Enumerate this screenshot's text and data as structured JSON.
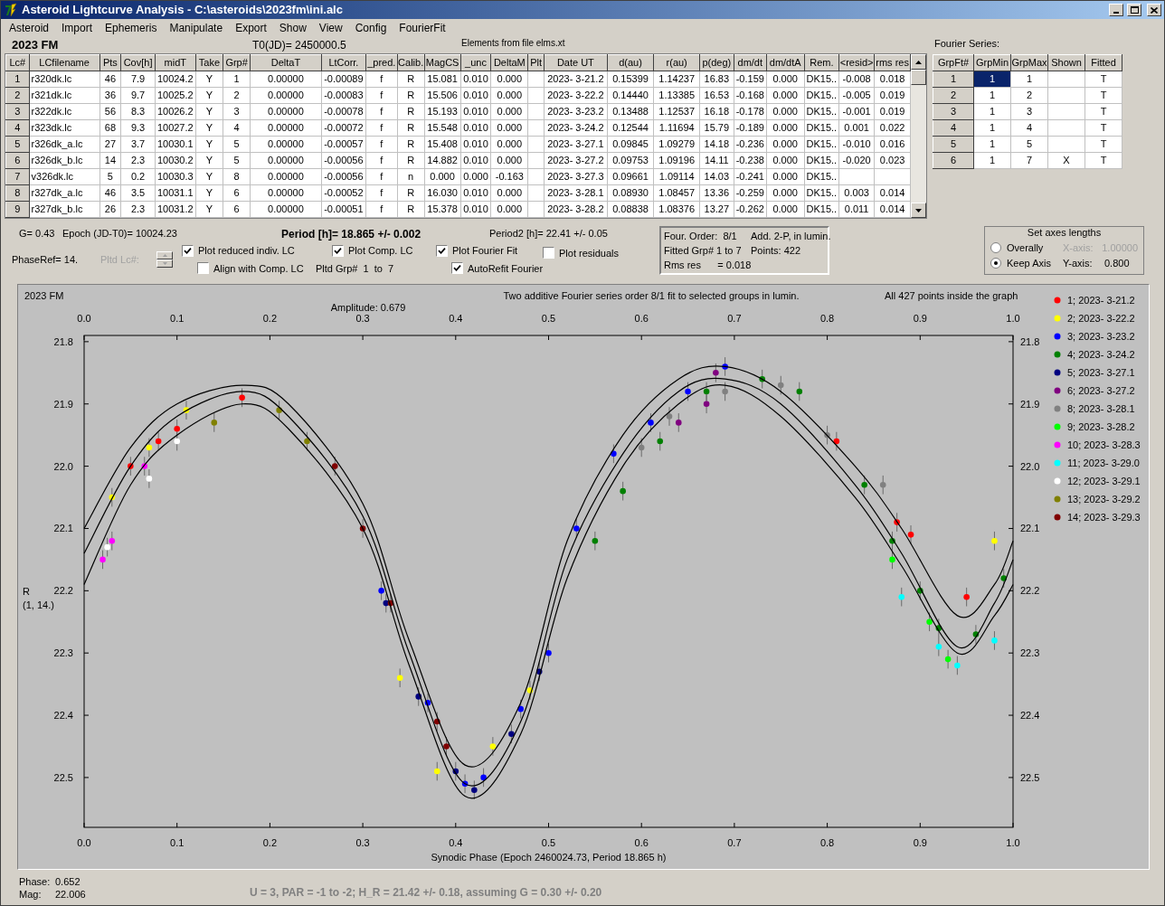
{
  "window": {
    "title": "Asteroid Lightcurve Analysis - C:\\asteroids\\2023fm\\ini.alc"
  },
  "menu": [
    "Asteroid",
    "Import",
    "Ephemeris",
    "Manipulate",
    "Export",
    "Show",
    "View",
    "Config",
    "FourierFit"
  ],
  "asteroid_name": "2023 FM",
  "t0": "T0(JD)= 2450000.5",
  "elements_note": "Elements from file elms.xt",
  "lc_table": {
    "columns": [
      "Lc#",
      "LCfilename",
      "Pts",
      "Cov[h]",
      "midT",
      "Take",
      "Grp#",
      "DeltaT",
      "LtCorr.",
      "_pred.",
      "Calib.",
      "MagCS",
      "_unc",
      "DeltaM",
      "Plt",
      "Date UT",
      "d(au)",
      "r(au)",
      "p(deg)",
      "dm/dt",
      "dm/dtA",
      "Rem.",
      "<resid>",
      "rms res"
    ],
    "rows": [
      {
        "cells": [
          "1",
          "r320dk.lc",
          "46",
          "7.9",
          "10024.2",
          "Y",
          "1",
          "0.00000",
          "-0.00089",
          "f",
          "R",
          "15.081",
          "0.010",
          "0.000",
          null,
          "2023- 3-21.2",
          "0.15399",
          "1.14237",
          "16.83",
          "-0.159",
          "0.000",
          "DK15..",
          "-0.008",
          "0.018"
        ]
      },
      {
        "cells": [
          "2",
          "r321dk.lc",
          "36",
          "9.7",
          "10025.2",
          "Y",
          "2",
          "0.00000",
          "-0.00083",
          "f",
          "R",
          "15.506",
          "0.010",
          "0.000",
          null,
          "2023- 3-22.2",
          "0.14440",
          "1.13385",
          "16.53",
          "-0.168",
          "0.000",
          "DK15..",
          "-0.005",
          "0.019"
        ]
      },
      {
        "cells": [
          "3",
          "r322dk.lc",
          "56",
          "8.3",
          "10026.2",
          "Y",
          "3",
          "0.00000",
          "-0.00078",
          "f",
          "R",
          "15.193",
          "0.010",
          "0.000",
          null,
          "2023- 3-23.2",
          "0.13488",
          "1.12537",
          "16.18",
          "-0.178",
          "0.000",
          "DK15..",
          "-0.001",
          "0.019"
        ]
      },
      {
        "cells": [
          "4",
          "r323dk.lc",
          "68",
          "9.3",
          "10027.2",
          "Y",
          "4",
          "0.00000",
          "-0.00072",
          "f",
          "R",
          "15.548",
          "0.010",
          "0.000",
          null,
          "2023- 3-24.2",
          "0.12544",
          "1.11694",
          "15.79",
          "-0.189",
          "0.000",
          "DK15..",
          "0.001",
          "0.022"
        ]
      },
      {
        "cells": [
          "5",
          "r326dk_a.lc",
          "27",
          "3.7",
          "10030.1",
          "Y",
          "5",
          "0.00000",
          "-0.00057",
          "f",
          "R",
          "15.408",
          "0.010",
          "0.000",
          null,
          "2023- 3-27.1",
          "0.09845",
          "1.09279",
          "14.18",
          "-0.236",
          "0.000",
          "DK15..",
          "-0.010",
          "0.016"
        ]
      },
      {
        "cells": [
          "6",
          "r326dk_b.lc",
          "14",
          "2.3",
          "10030.2",
          "Y",
          "5",
          "0.00000",
          "-0.00056",
          "f",
          "R",
          "14.882",
          "0.010",
          "0.000",
          null,
          "2023- 3-27.2",
          "0.09753",
          "1.09196",
          "14.11",
          "-0.238",
          "0.000",
          "DK15..",
          "-0.020",
          "0.023"
        ]
      },
      {
        "cells": [
          "7",
          "v326dk.lc",
          "5",
          "0.2",
          "10030.3",
          "Y",
          "8",
          "0.00000",
          "-0.00056",
          "f",
          "n",
          "0.000",
          "0.000",
          "-0.163",
          null,
          "2023- 3-27.3",
          "0.09661",
          "1.09114",
          "14.03",
          "-0.241",
          "0.000",
          "DK15..",
          null,
          null
        ]
      },
      {
        "cells": [
          "8",
          "r327dk_a.lc",
          "46",
          "3.5",
          "10031.1",
          "Y",
          "6",
          "0.00000",
          "-0.00052",
          "f",
          "R",
          "16.030",
          "0.010",
          "0.000",
          null,
          "2023- 3-28.1",
          "0.08930",
          "1.08457",
          "13.36",
          "-0.259",
          "0.000",
          "DK15..",
          "0.003",
          "0.014"
        ]
      },
      {
        "cells": [
          "9",
          "r327dk_b.lc",
          "26",
          "2.3",
          "10031.2",
          "Y",
          "6",
          "0.00000",
          "-0.00051",
          "f",
          "R",
          "15.378",
          "0.010",
          "0.000",
          null,
          "2023- 3-28.2",
          "0.08838",
          "1.08376",
          "13.27",
          "-0.262",
          "0.000",
          "DK15..",
          "0.011",
          "0.014"
        ]
      }
    ]
  },
  "fourier": {
    "label": "Fourier Series:",
    "columns": [
      "GrpFt#",
      "GrpMin",
      "GrpMax",
      "Shown",
      "Fitted"
    ],
    "rows": [
      {
        "cells": [
          "1",
          "1",
          "1",
          null,
          "T"
        ],
        "selected": true
      },
      {
        "cells": [
          "2",
          "1",
          "2",
          null,
          "T"
        ],
        "selected": false
      },
      {
        "cells": [
          "3",
          "1",
          "3",
          null,
          "T"
        ],
        "selected": false
      },
      {
        "cells": [
          "4",
          "1",
          "4",
          null,
          "T"
        ],
        "selected": false
      },
      {
        "cells": [
          "5",
          "1",
          "5",
          null,
          "T"
        ],
        "selected": false
      },
      {
        "cells": [
          "6",
          "1",
          "7",
          "X",
          "T"
        ],
        "selected": false
      }
    ]
  },
  "params": {
    "g": "G= 0.43",
    "epoch": "Epoch (JD-T0)= 10024.23",
    "period": "Period [h]= 18.865 +/- 0.002",
    "period2": "Period2 [h]= 22.41 +/- 0.05",
    "phase_ref": "PhaseRef= 14.",
    "pltd_grp": "Pltd Grp#  1  to  7"
  },
  "pltd_lc": {
    "label": "Pltd Lc#:",
    "disabled": true
  },
  "checkboxes": [
    {
      "label": "Plot reduced indiv. LC",
      "checked": true
    },
    {
      "label": "Align with Comp. LC",
      "checked": false
    },
    {
      "label": "Plot Comp. LC",
      "checked": true
    },
    {
      "label": "Plot Fourier Fit",
      "checked": true
    },
    {
      "label": "AutoRefit Fourier",
      "checked": true
    },
    {
      "label": "Plot residuals",
      "checked": false
    }
  ],
  "fit_info": [
    "Four. Order:  8/1",
    "Add. 2-P, in lumin.",
    "Fitted Grp# 1 to 7",
    "Points: 422",
    "Rms res      = 0.018"
  ],
  "axes_box": {
    "title": "Set axes lengths",
    "options": [
      {
        "label": "Overally",
        "selected": false
      },
      {
        "label": "Keep Axis",
        "selected": true
      }
    ],
    "axes": [
      {
        "label": "X-axis:",
        "value": "1.00000",
        "disabled": true
      },
      {
        "label": "Y-axis:",
        "value": "0.800",
        "disabled": false
      }
    ]
  },
  "plot": {
    "corner_label": "2023 FM",
    "amplitude": "Amplitude: 0.679",
    "note": "All 427 points inside the graph",
    "ylabel_sub": "(1, 14.)",
    "chart_data": {
      "type": "scatter",
      "title": "Two additive Fourier series order 8/1 fit to selected groups in lumin.",
      "xlabel": "Synodic Phase (Epoch 2460024.73, Period 18.865 h)",
      "ylabel": "R",
      "xlim": [
        0,
        1
      ],
      "ylim": [
        22.58,
        21.79
      ],
      "legend": "right",
      "xticks": [
        {
          "value": 0,
          "label": "0.0"
        },
        {
          "value": 0.1,
          "label": "0.1"
        },
        {
          "value": 0.2,
          "label": "0.2"
        },
        {
          "value": 0.3,
          "label": "0.3"
        },
        {
          "value": 0.4,
          "label": "0.4"
        },
        {
          "value": 0.5,
          "label": "0.5"
        },
        {
          "value": 0.6,
          "label": "0.6"
        },
        {
          "value": 0.7,
          "label": "0.7"
        },
        {
          "value": 0.8,
          "label": "0.8"
        },
        {
          "value": 0.9,
          "label": "0.9"
        },
        {
          "value": 1,
          "label": "1.0"
        }
      ],
      "yticks": [
        21.8,
        21.9,
        {
          "value": 22,
          "label": "22.0"
        },
        22.1,
        22.2,
        22.3,
        22.4,
        22.5
      ],
      "series": [
        {
          "name": "1; 2023- 3-21.2",
          "color": "#ff0000",
          "x": [
            0.05,
            0.08,
            0.1,
            0.17,
            0.81,
            0.875,
            0.89,
            0.95
          ],
          "values": [
            22.0,
            21.96,
            21.94,
            21.89,
            21.96,
            22.09,
            22.11,
            22.21
          ]
        },
        {
          "name": "2; 2023- 3-22.2",
          "color": "#ffff00",
          "x": [
            0.03,
            0.07,
            0.11,
            0.34,
            0.38,
            0.44,
            0.48,
            0.98
          ],
          "values": [
            22.05,
            21.97,
            21.91,
            22.34,
            22.49,
            22.45,
            22.36,
            22.12
          ]
        },
        {
          "name": "3; 2023- 3-23.2",
          "color": "#0000ff",
          "x": [
            0.32,
            0.37,
            0.41,
            0.43,
            0.47,
            0.5,
            0.53,
            0.57,
            0.61,
            0.65,
            0.69
          ],
          "values": [
            22.2,
            22.38,
            22.51,
            22.5,
            22.39,
            22.3,
            22.1,
            21.98,
            21.93,
            21.88,
            21.84
          ]
        },
        {
          "name": "4; 2023- 3-24.2",
          "color": "#008000",
          "x": [
            0.55,
            0.58,
            0.62,
            0.67,
            0.73,
            0.77,
            0.84,
            0.87,
            0.9,
            0.92,
            0.96,
            0.99
          ],
          "values": [
            22.12,
            22.04,
            21.96,
            21.88,
            21.86,
            21.88,
            22.03,
            22.12,
            22.2,
            22.26,
            22.27,
            22.18
          ]
        },
        {
          "name": "5; 2023- 3-27.1",
          "color": "#000080",
          "x": [
            0.325,
            0.36,
            0.4,
            0.42,
            0.46,
            0.49
          ],
          "values": [
            22.22,
            22.37,
            22.49,
            22.52,
            22.43,
            22.33
          ]
        },
        {
          "name": "6; 2023- 3-27.2",
          "color": "#800080",
          "x": [
            0.64,
            0.67,
            0.68
          ],
          "values": [
            21.93,
            21.9,
            21.85
          ]
        },
        {
          "name": "8; 2023- 3-28.1",
          "color": "#808080",
          "x": [
            0.6,
            0.63,
            0.69,
            0.75,
            0.8,
            0.86
          ],
          "values": [
            21.97,
            21.92,
            21.88,
            21.87,
            21.95,
            22.03
          ]
        },
        {
          "name": "9; 2023- 3-28.2",
          "color": "#00ff00",
          "x": [
            0.87,
            0.91,
            0.93
          ],
          "values": [
            22.15,
            22.25,
            22.31
          ]
        },
        {
          "name": "10; 2023- 3-28.3",
          "color": "#ff00ff",
          "x": [
            0.02,
            0.03,
            0.065
          ],
          "values": [
            22.15,
            22.12,
            22.0
          ]
        },
        {
          "name": "11; 2023- 3-29.0",
          "color": "#00ffff",
          "x": [
            0.88,
            0.92,
            0.94,
            0.98
          ],
          "values": [
            22.21,
            22.29,
            22.32,
            22.28
          ]
        },
        {
          "name": "12; 2023- 3-29.1",
          "color": "#ffffff",
          "x": [
            0.025,
            0.07,
            0.1
          ],
          "values": [
            22.13,
            22.02,
            21.96
          ]
        },
        {
          "name": "13; 2023- 3-29.2",
          "color": "#808000",
          "x": [
            0.14,
            0.21,
            0.24
          ],
          "values": [
            21.93,
            21.91,
            21.96
          ]
        },
        {
          "name": "14; 2023- 3-29.3",
          "color": "#800000",
          "x": [
            0.27,
            0.3,
            0.33,
            0.38,
            0.39
          ],
          "values": [
            22.0,
            22.1,
            22.22,
            22.41,
            22.45
          ]
        },
        {
          "type": "line",
          "color": "#000000",
          "x": [
            0,
            0.05,
            0.1,
            0.17,
            0.22,
            0.3,
            0.35,
            0.41,
            0.47,
            0.52,
            0.58,
            0.64,
            0.69,
            0.75,
            0.83,
            0.88,
            0.94,
            0.98,
            1
          ],
          "values": [
            22.1,
            21.97,
            21.9,
            21.87,
            21.9,
            22.06,
            22.28,
            22.48,
            22.38,
            22.12,
            21.95,
            21.86,
            21.84,
            21.88,
            22.0,
            22.1,
            22.24,
            22.19,
            22.12
          ]
        },
        {
          "type": "line",
          "color": "#000000",
          "x": [
            0,
            0.05,
            0.1,
            0.17,
            0.22,
            0.3,
            0.35,
            0.41,
            0.47,
            0.52,
            0.58,
            0.64,
            0.69,
            0.75,
            0.83,
            0.88,
            0.94,
            0.98,
            1
          ],
          "values": [
            22.14,
            22.0,
            21.92,
            21.88,
            21.92,
            22.08,
            22.3,
            22.51,
            22.41,
            22.15,
            21.98,
            21.88,
            21.86,
            21.9,
            22.03,
            22.14,
            22.29,
            22.22,
            22.15
          ]
        },
        {
          "type": "line",
          "color": "#000000",
          "x": [
            0,
            0.05,
            0.1,
            0.17,
            0.22,
            0.3,
            0.35,
            0.41,
            0.47,
            0.52,
            0.58,
            0.64,
            0.69,
            0.75,
            0.83,
            0.88,
            0.94,
            0.98,
            1
          ],
          "values": [
            22.19,
            22.03,
            21.95,
            21.9,
            21.94,
            22.1,
            22.32,
            22.53,
            22.43,
            22.18,
            22.0,
            21.9,
            21.87,
            21.92,
            22.05,
            22.16,
            22.3,
            22.24,
            22.19
          ]
        }
      ]
    },
    "right_yticks": [
      "21.8",
      "21.9",
      "22.0",
      "22.1",
      "22.2",
      "22.3",
      "22.4",
      "22.5"
    ]
  },
  "status": {
    "phase_label": "Phase:",
    "phase": "0.652",
    "mag_label": "Mag:",
    "mag": "22.006",
    "note": "U = 3, PAR = -1 to -2; H_R = 21.42 +/- 0.18, assuming G = 0.30 +/- 0.20"
  }
}
